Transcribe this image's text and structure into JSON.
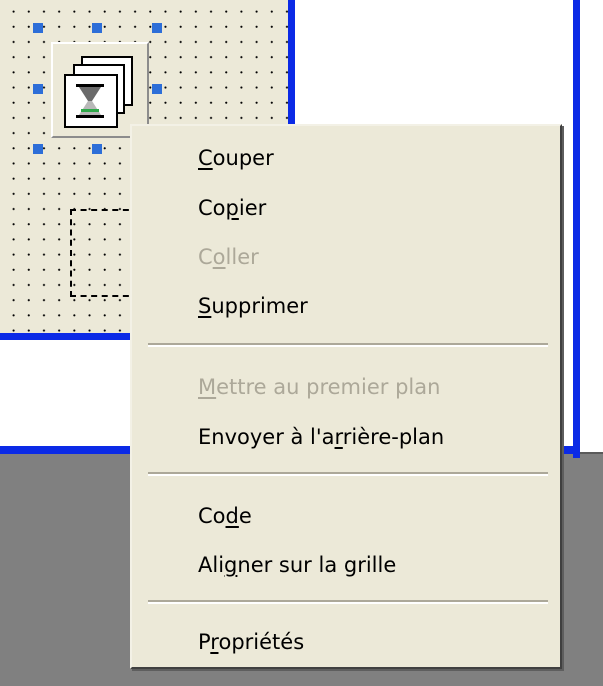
{
  "context_menu": {
    "groups": [
      [
        {
          "id": "couper",
          "label": "Couper",
          "mnemonic_index": 0,
          "disabled": false
        },
        {
          "id": "copier",
          "label": "Copier",
          "mnemonic_index": 2,
          "disabled": false
        },
        {
          "id": "coller",
          "label": "Coller",
          "mnemonic_index": 1,
          "disabled": true
        },
        {
          "id": "supprimer",
          "label": "Supprimer",
          "mnemonic_index": 0,
          "disabled": false
        }
      ],
      [
        {
          "id": "premier-plan",
          "label": "Mettre au premier plan",
          "mnemonic_index": 0,
          "disabled": true
        },
        {
          "id": "arriere-plan",
          "label": "Envoyer à l'arrière-plan",
          "mnemonic_index": 13,
          "disabled": false
        }
      ],
      [
        {
          "id": "code",
          "label": "Code",
          "mnemonic_index": 2,
          "disabled": false
        },
        {
          "id": "grille",
          "label": "Aligner sur la grille",
          "mnemonic_index": 3,
          "disabled": false
        }
      ],
      [
        {
          "id": "proprietes",
          "label": "Propriétés",
          "mnemonic_index": 1,
          "disabled": false
        }
      ]
    ]
  },
  "colors": {
    "designer_background": "#ece9d8",
    "frame_blue": "#0b2ae6",
    "handle_blue": "#2d6ed8",
    "disabled_text": "#aca899",
    "workspace_gray": "#808080"
  },
  "icons": {
    "selected_control": "stacked-frames-hourglass-icon"
  }
}
